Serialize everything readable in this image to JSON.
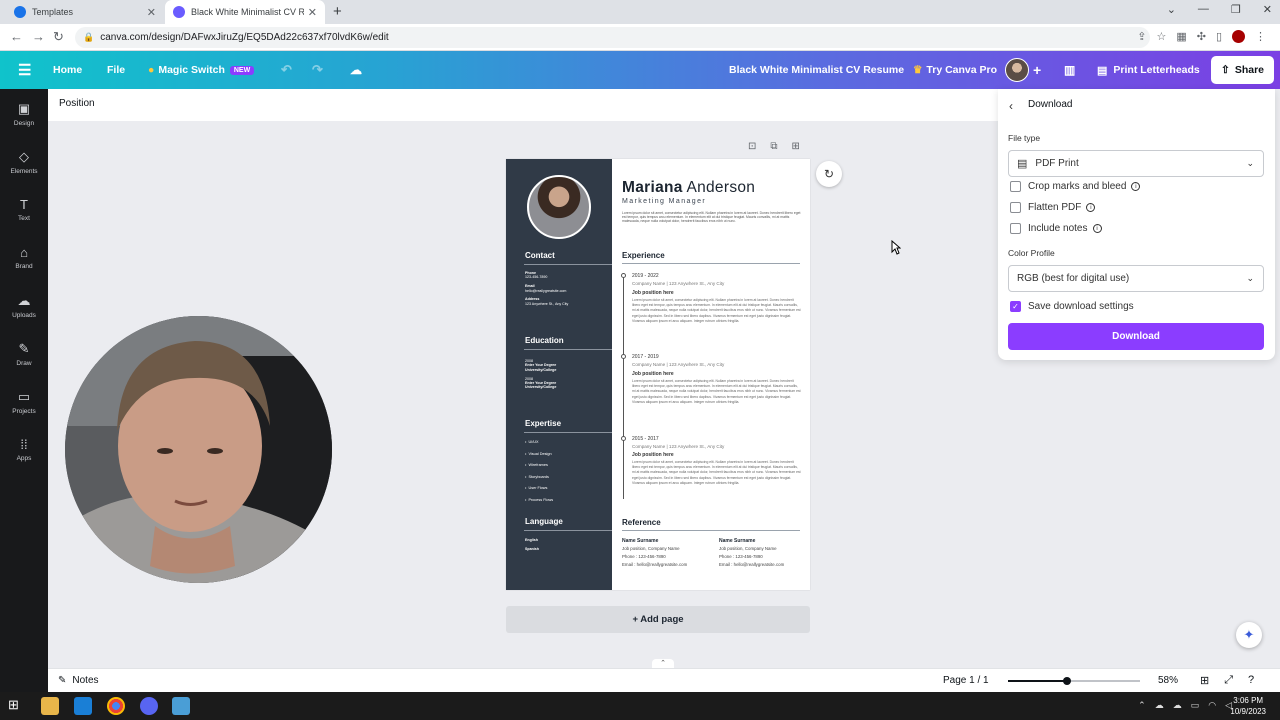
{
  "browser": {
    "tabs": [
      {
        "title": "Templates",
        "favicon_color": "#1a73e8"
      },
      {
        "title": "Black White Minimalist CV Resume",
        "favicon_color": "#6a5cff"
      }
    ],
    "new_tab": "+",
    "url": "canva.com/design/DAFwxJiruZg/EQ5DAd22c637xf70lvdK6w/edit"
  },
  "topbar": {
    "home": "Home",
    "file": "File",
    "magic_switch": "Magic Switch",
    "magic_badge": "NEW",
    "doc_title": "Black White Minimalist CV Resume",
    "try_pro": "Try Canva Pro",
    "print": "Print Letterheads",
    "share": "Share"
  },
  "sidebar": {
    "items": [
      {
        "label": "Design",
        "icon": "design-icon"
      },
      {
        "label": "Elements",
        "icon": "elements-icon"
      },
      {
        "label": "Text",
        "icon": "text-icon"
      },
      {
        "label": "Brand",
        "icon": "brand-icon"
      },
      {
        "label": "Uploads",
        "icon": "uploads-icon"
      },
      {
        "label": "Draw",
        "icon": "draw-icon"
      },
      {
        "label": "Projects",
        "icon": "projects-icon"
      },
      {
        "label": "Apps",
        "icon": "apps-icon"
      }
    ]
  },
  "context": {
    "position": "Position"
  },
  "resume": {
    "first_name": "Mariana",
    "last_name": "Anderson",
    "role": "Marketing Manager",
    "summary": "Lorem ipsum dolor sit amet, consectetur adipiscing elit. Nullam pharetra in lorem at laoreet. Donec hendrerit libero eget est tempor, quis tempus arcu elementum. In elementum elit at dui tristique feugiat. Mauris convallis, mi at mattis malesuada, neque nulla volutpat dolor, hendrerit faucibus eros nibh ut nunc.",
    "contact_heading": "Contact",
    "phone_label": "Phone",
    "phone": "123-456-7890",
    "email_label": "Email",
    "email": "hello@reallygreatsite.com",
    "address_label": "Address",
    "address": "123 Anywhere St., Any City",
    "education_heading": "Education",
    "education": [
      {
        "year": "2008",
        "degree": "Enter Your Degree",
        "school": "University/College"
      },
      {
        "year": "2008",
        "degree": "Enter Your Degree",
        "school": "University/College"
      }
    ],
    "expertise_heading": "Expertise",
    "expertise": [
      "UI/UX",
      "Visual Design",
      "Wireframes",
      "Storyboards",
      "User Flows",
      "Process Flows"
    ],
    "language_heading": "Language",
    "languages": [
      "English",
      "Spanish"
    ],
    "experience_heading": "Experience",
    "experience": [
      {
        "dates": "2019 - 2022",
        "company": "Company Name | 123 Anywhere St., Any City",
        "position": "Job position here"
      },
      {
        "dates": "2017 - 2019",
        "company": "Company Name | 123 Anywhere St., Any City",
        "position": "Job position here"
      },
      {
        "dates": "2015 - 2017",
        "company": "Company Name | 123 Anywhere St., Any City",
        "position": "Job position here"
      }
    ],
    "experience_body": "Lorem ipsum dolor sit amet, consectetur adipiscing elit. Nullam pharetra in lorem at laoreet. Donec hendrerit libero eget est tempor, quis tempus arcu elementum. In elementum elit at dui tristique feugiat. Mauris convallis, mi at mattis malesuada, neque nulla volutpat dolor, hendrerit faucibus eros nibh ut nunc. Vivamus fermentum est eget justo dignissim. Sed in libero sed libero dapibus. Vivamus fermentum est eget justo dignissim feugiat. Vivamus aliquam ipsum et arcu aliquam. Integer rutrum ultrices fringilla.",
    "reference_heading": "Reference",
    "references": [
      {
        "name": "Name Surname",
        "title": "Job position, Company Name",
        "phone_label": "Phone :",
        "phone": "123-456-7890",
        "email_label": "Email :",
        "email": "hello@reallygreatsite.com"
      },
      {
        "name": "Name Surname",
        "title": "Job position, Company Name",
        "phone_label": "Phone :",
        "phone": "123-456-7890",
        "email_label": "Email :",
        "email": "hello@reallygreatsite.com"
      }
    ]
  },
  "add_page": "+ Add page",
  "download_panel": {
    "title": "Download",
    "file_type_label": "File type",
    "file_type": "PDF Print",
    "options": [
      {
        "label": "Crop marks and bleed",
        "checked": false
      },
      {
        "label": "Flatten PDF",
        "checked": false
      },
      {
        "label": "Include notes",
        "checked": false
      }
    ],
    "color_profile_label": "Color Profile",
    "color_profile": "RGB (best for digital use)",
    "save_settings": "Save download settings",
    "save_settings_checked": true,
    "button": "Download"
  },
  "bottombar": {
    "notes": "Notes",
    "page": "Page 1 / 1",
    "zoom_label": "58%",
    "zoom_slider_fraction": 0.45
  },
  "taskbar": {
    "time": "3:06 PM",
    "date": "10/9/2023"
  },
  "colors": {
    "accent_purple": "#8b3dff",
    "resume_sidebar": "#303a47",
    "sidebar_bg": "#18191b"
  }
}
